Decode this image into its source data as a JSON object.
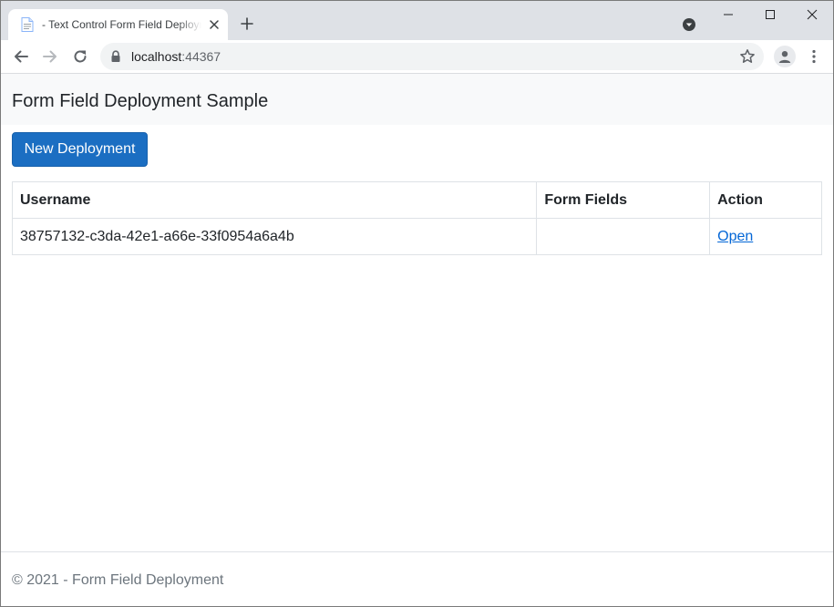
{
  "browser": {
    "tab": {
      "title": "- Text Control Form Field Deployment Sample",
      "favicon": "document-icon"
    },
    "address_bar": {
      "host": "localhost",
      "port": ":44367"
    },
    "icons": {
      "back": "arrow-left-icon",
      "forward": "arrow-right-icon",
      "reload": "reload-icon",
      "bookmark": "star-icon",
      "profile": "person-icon",
      "menu": "kebab-icon"
    }
  },
  "app": {
    "brand": "Form Field Deployment Sample",
    "new_deployment_label": "New Deployment",
    "accent_color": "#1b6ec2",
    "table": {
      "headers": [
        "Username",
        "Form Fields",
        "Action"
      ],
      "rows": [
        {
          "username": "38757132-c3da-42e1-a66e-33f0954a6a4b",
          "form_fields": "",
          "action": "Open"
        }
      ]
    },
    "footer": "© 2021 - Form Field Deployment"
  }
}
